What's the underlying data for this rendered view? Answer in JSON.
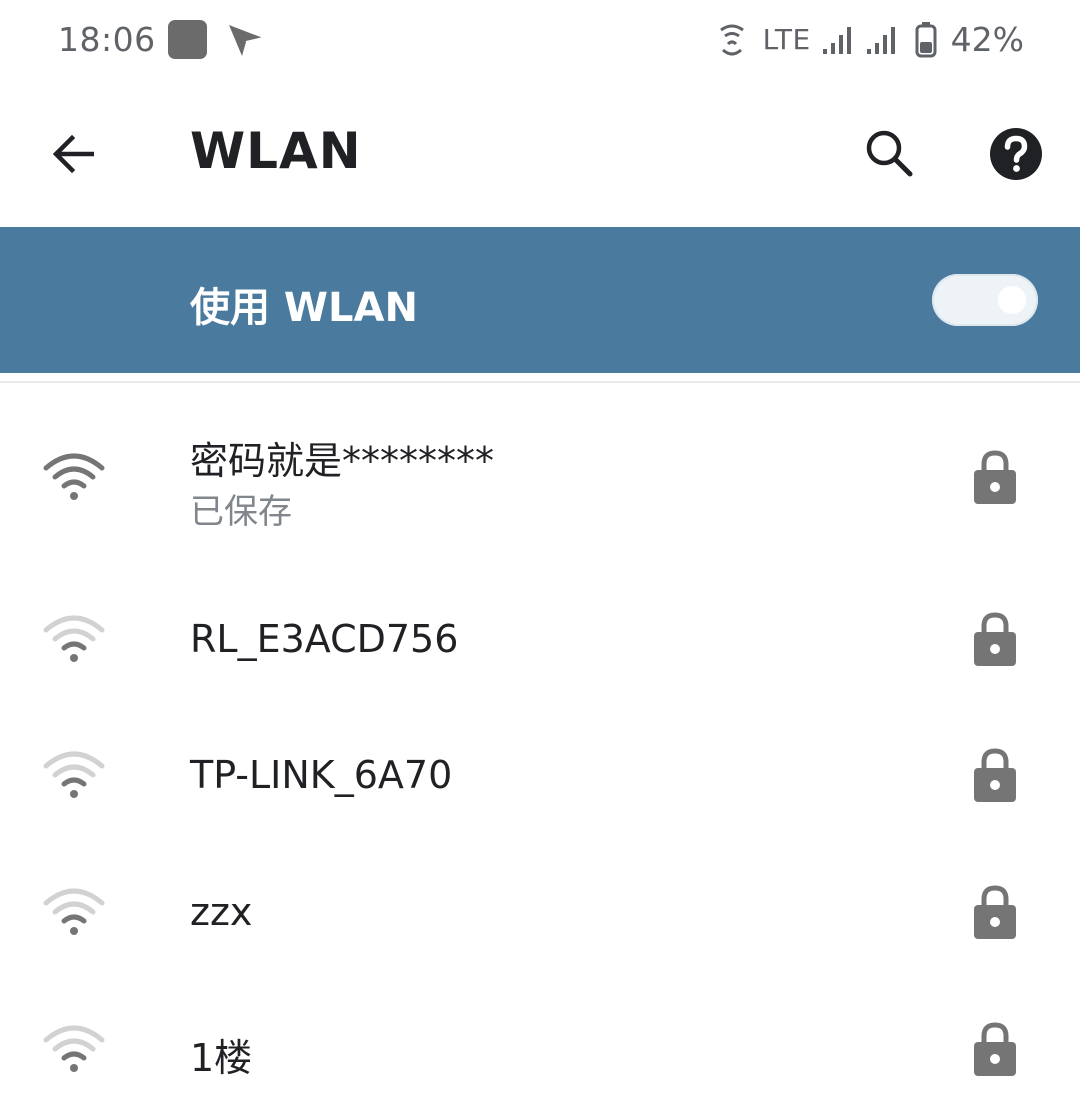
{
  "status_bar": {
    "time": "18:06",
    "network_type": "LTE",
    "battery": "42%"
  },
  "app_bar": {
    "title": "WLAN"
  },
  "master_switch": {
    "label": "使用 WLAN",
    "enabled": true,
    "background_color": "#4a7a9e"
  },
  "networks": [
    {
      "ssid": "密码就是********",
      "status": "已保存",
      "secured": true,
      "signal": "strong"
    },
    {
      "ssid": "RL_E3ACD756",
      "status": "",
      "secured": true,
      "signal": "weak"
    },
    {
      "ssid": "TP-LINK_6A70",
      "status": "",
      "secured": true,
      "signal": "weak"
    },
    {
      "ssid": "zzx",
      "status": "",
      "secured": true,
      "signal": "weak"
    },
    {
      "ssid": "1楼",
      "status": "",
      "secured": true,
      "signal": "weak"
    }
  ],
  "icons": {
    "back": "arrow-back-icon",
    "search": "search-icon",
    "help": "help-icon",
    "wifi": "wifi-icon",
    "lock": "lock-icon"
  }
}
